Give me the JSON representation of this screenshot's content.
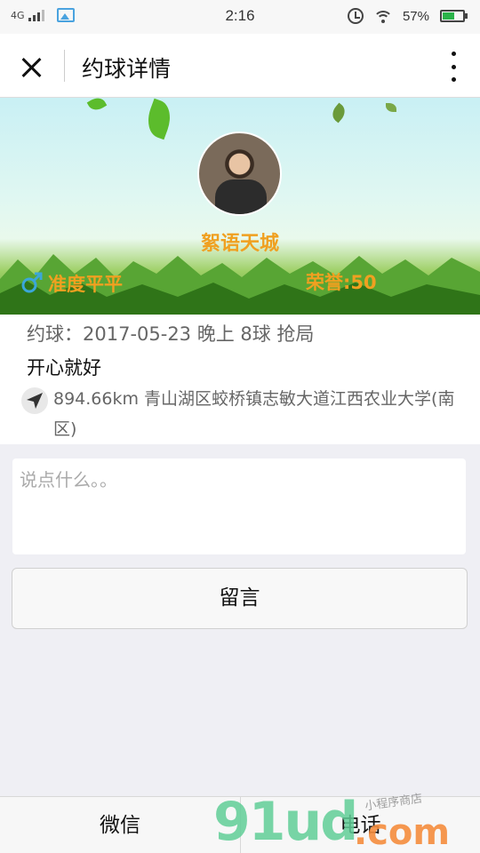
{
  "status_bar": {
    "network": "4G",
    "time": "2:16",
    "battery": "57%",
    "battery_level": 0.57
  },
  "nav": {
    "title": "约球详情"
  },
  "banner": {
    "name": "絮语天城",
    "level": "准度平平",
    "honor": "荣誉:50"
  },
  "info": {
    "match": "约球：2017-05-23 晚上 8球 抢局",
    "note": "开心就好",
    "location": "894.66km 青山湖区蛟桥镇志敏大道江西农业大学(南区)"
  },
  "comment": {
    "placeholder": "说点什么。。",
    "submit_label": "留言"
  },
  "bottom_bar": {
    "wechat_label": "微信",
    "phone_label": "电话"
  },
  "watermark": {
    "main": "91ud",
    "domain": ".com",
    "sub": "小程序商店"
  },
  "colors": {
    "accent": "#f0a020",
    "gender": "#3ba7d9",
    "watermark_green": "#60ce96",
    "watermark_orange": "#f48c3c"
  }
}
